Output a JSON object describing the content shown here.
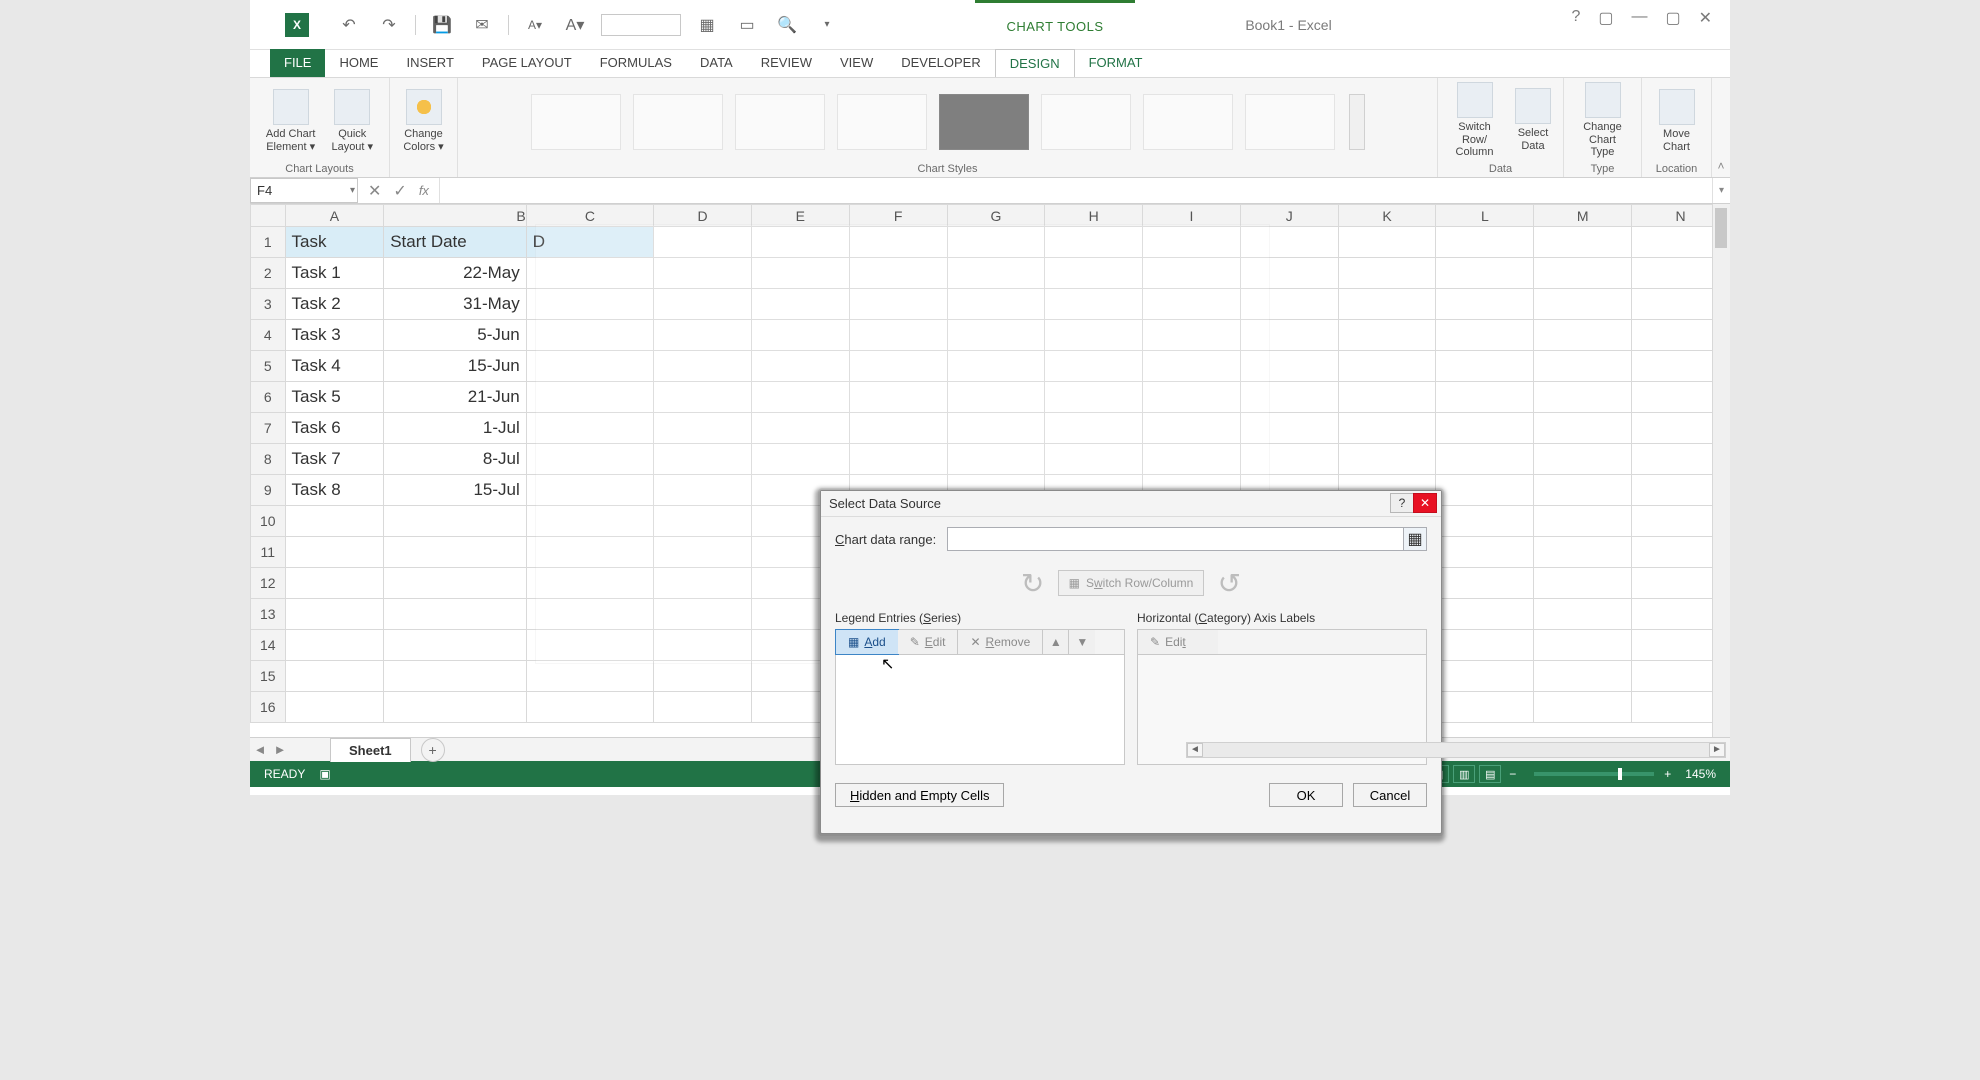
{
  "title": "Book1 - Excel",
  "chart_tools": "CHART TOOLS",
  "tabs": {
    "file": "FILE",
    "home": "HOME",
    "insert": "INSERT",
    "page_layout": "PAGE LAYOUT",
    "formulas": "FORMULAS",
    "data": "DATA",
    "review": "REVIEW",
    "view": "VIEW",
    "developer": "DEVELOPER",
    "design": "DESIGN",
    "format": "FORMAT"
  },
  "ribbon": {
    "add_chart_element": "Add Chart\nElement ▾",
    "quick_layout": "Quick\nLayout ▾",
    "change_colors": "Change\nColors ▾",
    "switch_row_col": "Switch Row/\nColumn",
    "select_data": "Select\nData",
    "change_chart_type": "Change\nChart Type",
    "move_chart": "Move\nChart",
    "groups": {
      "chart_layouts": "Chart Layouts",
      "chart_styles": "Chart Styles",
      "data": "Data",
      "type": "Type",
      "location": "Location"
    }
  },
  "namebox": "F4",
  "columns": [
    "A",
    "B",
    "C",
    "D",
    "E",
    "F",
    "G",
    "H",
    "I",
    "J",
    "K",
    "L",
    "M",
    "N"
  ],
  "rows": [
    "1",
    "2",
    "3",
    "4",
    "5",
    "6",
    "7",
    "8",
    "9",
    "10",
    "11",
    "12",
    "13",
    "14",
    "15",
    "16"
  ],
  "headers": {
    "A": "Task",
    "B": "Start Date",
    "C": "D"
  },
  "data": [
    {
      "A": "Task 1",
      "B": "22-May"
    },
    {
      "A": "Task 2",
      "B": "31-May"
    },
    {
      "A": "Task 3",
      "B": "5-Jun"
    },
    {
      "A": "Task 4",
      "B": "15-Jun"
    },
    {
      "A": "Task 5",
      "B": "21-Jun"
    },
    {
      "A": "Task 6",
      "B": "1-Jul"
    },
    {
      "A": "Task 7",
      "B": "8-Jul"
    },
    {
      "A": "Task 8",
      "B": "15-Jul"
    }
  ],
  "dialog": {
    "title": "Select Data Source",
    "range_label": "Chart data range:",
    "switch": "Switch Row/Column",
    "legend_label": "Legend Entries (Series)",
    "axis_label": "Horizontal (Category) Axis Labels",
    "add": "Add",
    "edit": "Edit",
    "remove": "Remove",
    "hidden": "Hidden and Empty Cells",
    "ok": "OK",
    "cancel": "Cancel"
  },
  "sheet_tab": "Sheet1",
  "status": {
    "ready": "READY",
    "zoom": "145%"
  }
}
